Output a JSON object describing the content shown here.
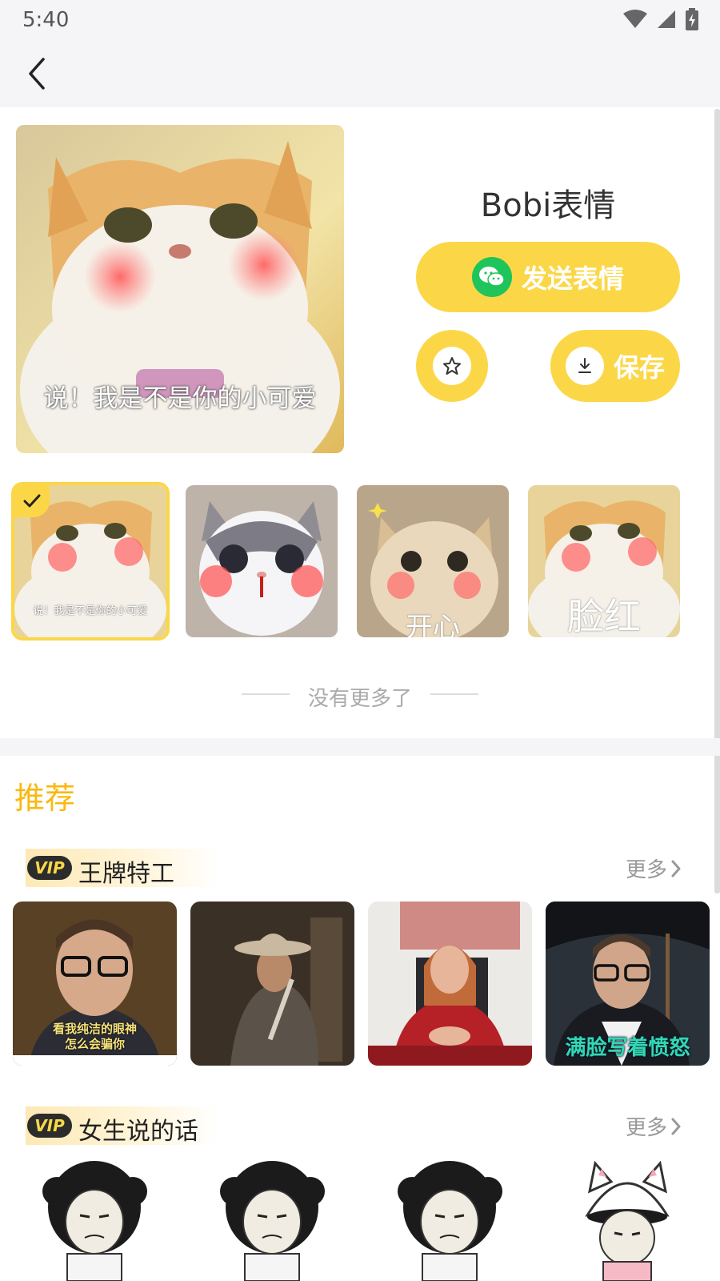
{
  "status_bar": {
    "time": "5:40"
  },
  "pack": {
    "title": "Bobi表情",
    "send_label": "发送表情",
    "save_label": "保存",
    "preview_caption": "说！我是不是你的小可爱"
  },
  "thumbnails": [
    {
      "caption": "说！我是不是你的小可爱",
      "selected": true
    },
    {
      "caption": "",
      "selected": false
    },
    {
      "caption": "开心",
      "selected": false
    },
    {
      "caption": "脸红",
      "selected": false
    }
  ],
  "no_more_text": "没有更多了",
  "recommend": {
    "title": "推荐",
    "packs": [
      {
        "vip_label": "VIP",
        "name": "王牌特工",
        "more_label": "更多",
        "thumb_captions": [
          "看我纯洁的眼神\n怎么会骗你",
          "",
          "",
          "满脸写着愤怒"
        ]
      },
      {
        "vip_label": "VIP",
        "name": "女生说的话",
        "more_label": "更多",
        "thumb_captions": [
          "",
          "",
          "",
          ""
        ]
      }
    ]
  },
  "colors": {
    "accent_yellow": "#fbd748",
    "section_title": "#fbb80f",
    "wechat_green": "#1fc45a"
  }
}
